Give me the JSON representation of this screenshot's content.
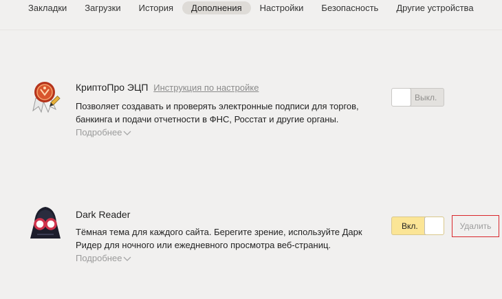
{
  "nav": {
    "tabs": [
      {
        "label": "Закладки",
        "active": false
      },
      {
        "label": "Загрузки",
        "active": false
      },
      {
        "label": "История",
        "active": false
      },
      {
        "label": "Дополнения",
        "active": true
      },
      {
        "label": "Настройки",
        "active": false
      },
      {
        "label": "Безопасность",
        "active": false
      },
      {
        "label": "Другие устройства",
        "active": false
      }
    ]
  },
  "extensions": [
    {
      "name": "КриптоПро ЭЦП",
      "link": "Инструкция по настройке",
      "description": "Позволяет создавать и проверять электронные подписи для торгов, банкинга и подачи отчетности в ФНС, Росстат и другие органы.",
      "more": "Подробнее",
      "toggle_label": "Выкл.",
      "enabled": false,
      "icon": "cryptopro-seal-icon"
    },
    {
      "name": "Dark Reader",
      "description": "Тёмная тема для каждого сайта. Берегите зрение, используйте Дарк Ридер для ночного или ежедневного просмотра веб-страниц.",
      "more": "Подробнее",
      "toggle_label": "Вкл.",
      "enabled": true,
      "remove_label": "Удалить",
      "icon": "dark-reader-icon"
    }
  ],
  "colors": {
    "background": "#f1f0ef",
    "active_tab": "#dedbd7",
    "toggle_on": "#fbe596",
    "remove_border": "#d9262b"
  }
}
